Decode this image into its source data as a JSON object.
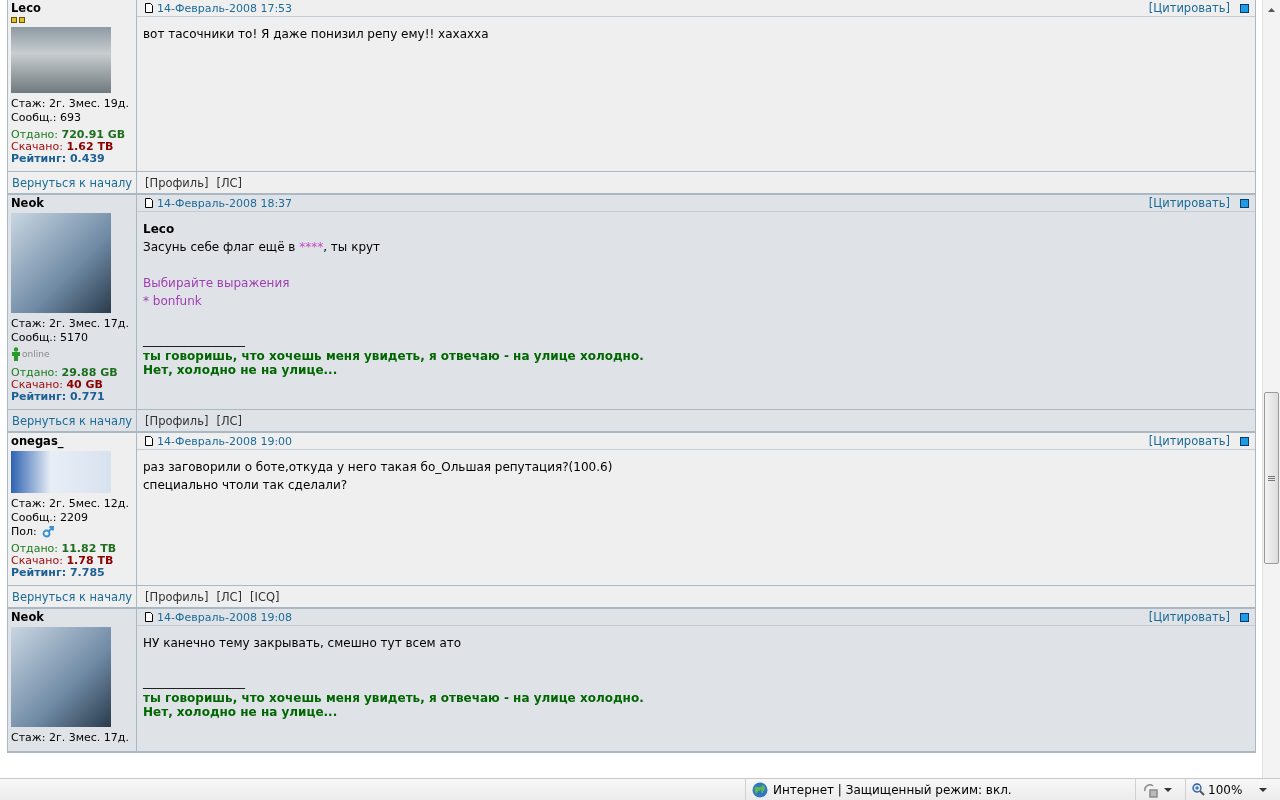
{
  "posts": [
    {
      "author": "Leco",
      "rank_marks": true,
      "avatar": {
        "kind": "truck"
      },
      "stats": [
        {
          "kind": "plain",
          "text": "Стаж: 2г. 3мес. 19д."
        },
        {
          "kind": "plain",
          "text": "Сообщ.: 693"
        },
        {
          "kind": "uploaded",
          "label": "Отдано:",
          "value": "720.91 GB"
        },
        {
          "kind": "downloaded",
          "label": "Скачано:",
          "value": "1.62 TB"
        },
        {
          "kind": "rating",
          "label": "Рейтинг:",
          "value": "0.439"
        }
      ],
      "date": "14-Февраль-2008 17:53",
      "quote_link": "[Цитировать]",
      "blocks": [
        {
          "kind": "text",
          "lines": [
            [
              {
                "text": "вот тасочники то! Я даже понизил репу ему!! хахахха",
                "censored": false
              }
            ]
          ]
        }
      ],
      "back_link": "Вернуться к началу",
      "links": [
        "[Профиль]",
        "[ЛС]"
      ]
    },
    {
      "author": "Neok",
      "rank_marks": false,
      "avatar": {
        "kind": "portrait"
      },
      "stats": [
        {
          "kind": "plain",
          "text": "Стаж: 2г. 3мес. 17д."
        },
        {
          "kind": "plain",
          "text": "Сообщ.: 5170"
        },
        {
          "kind": "online",
          "text": "online"
        },
        {
          "kind": "uploaded",
          "label": "Отдано:",
          "value": "29.88 GB"
        },
        {
          "kind": "downloaded",
          "label": "Скачано:",
          "value": "40 GB"
        },
        {
          "kind": "rating",
          "label": "Рейтинг:",
          "value": "0.771"
        }
      ],
      "date": "14-Февраль-2008 18:37",
      "quote_link": "[Цитировать]",
      "blocks": [
        {
          "kind": "quote",
          "author": "Leco",
          "lines": [
            [
              {
                "text": "Засунь себе флаг ещё в ",
                "censored": false
              },
              {
                "text": "****",
                "censored": true
              },
              {
                "text": ", ты крут",
                "censored": false
              }
            ]
          ]
        },
        {
          "kind": "highlight",
          "lines": [
            [
              {
                "text": "Выбирайте выражения",
                "censored": false
              }
            ],
            [
              {
                "text": "* bonfunk",
                "censored": false
              }
            ]
          ]
        }
      ],
      "signature": {
        "rule": "_________________",
        "lines": [
          "ты говоришь, что хочешь меня увидеть, я отвечаю - на улице холодно.",
          "Нет, холодно не на улице..."
        ]
      },
      "back_link": "Вернуться к началу",
      "links": [
        "[Профиль]",
        "[ЛС]"
      ]
    },
    {
      "author": "onegas_",
      "rank_marks": false,
      "avatar": {
        "kind": "badge"
      },
      "stats": [
        {
          "kind": "plain",
          "text": "Стаж: 2г. 5мес. 12д."
        },
        {
          "kind": "plain",
          "text": "Сообщ.: 2209"
        },
        {
          "kind": "gender",
          "text": "Пол:"
        },
        {
          "kind": "uploaded",
          "label": "Отдано:",
          "value": "11.82 TB"
        },
        {
          "kind": "downloaded",
          "label": "Скачано:",
          "value": "1.78 TB"
        },
        {
          "kind": "rating",
          "label": "Рейтинг:",
          "value": "7.785"
        }
      ],
      "date": "14-Февраль-2008 19:00",
      "quote_link": "[Цитировать]",
      "blocks": [
        {
          "kind": "text",
          "lines": [
            [
              {
                "text": "раз заговорили о боте,откуда у него такая бо_Ольшая репутация?(100.6)",
                "censored": false
              }
            ],
            [
              {
                "text": "специально чтоли так сделали?",
                "censored": false
              }
            ]
          ]
        }
      ],
      "back_link": "Вернуться к началу",
      "links": [
        "[Профиль]",
        "[ЛС]",
        "[ICQ]"
      ]
    },
    {
      "author": "Neok",
      "rank_marks": false,
      "avatar": {
        "kind": "portrait"
      },
      "stats": [
        {
          "kind": "plain",
          "text": "Стаж: 2г. 3мес. 17д."
        }
      ],
      "date": "14-Февраль-2008 19:08",
      "quote_link": "[Цитировать]",
      "blocks": [
        {
          "kind": "text",
          "lines": [
            [
              {
                "text": "НУ канечно тему закрывать, смешно тут всем ато",
                "censored": false
              }
            ]
          ]
        }
      ],
      "signature": {
        "rule": "_________________",
        "lines": [
          "ты говоришь, что хочешь меня увидеть, я отвечаю - на улице холодно.",
          "Нет, холодно не на улице..."
        ]
      }
    }
  ],
  "status_bar": {
    "zone": "Интернет | Защищенный режим: вкл.",
    "zoom": "100%"
  }
}
